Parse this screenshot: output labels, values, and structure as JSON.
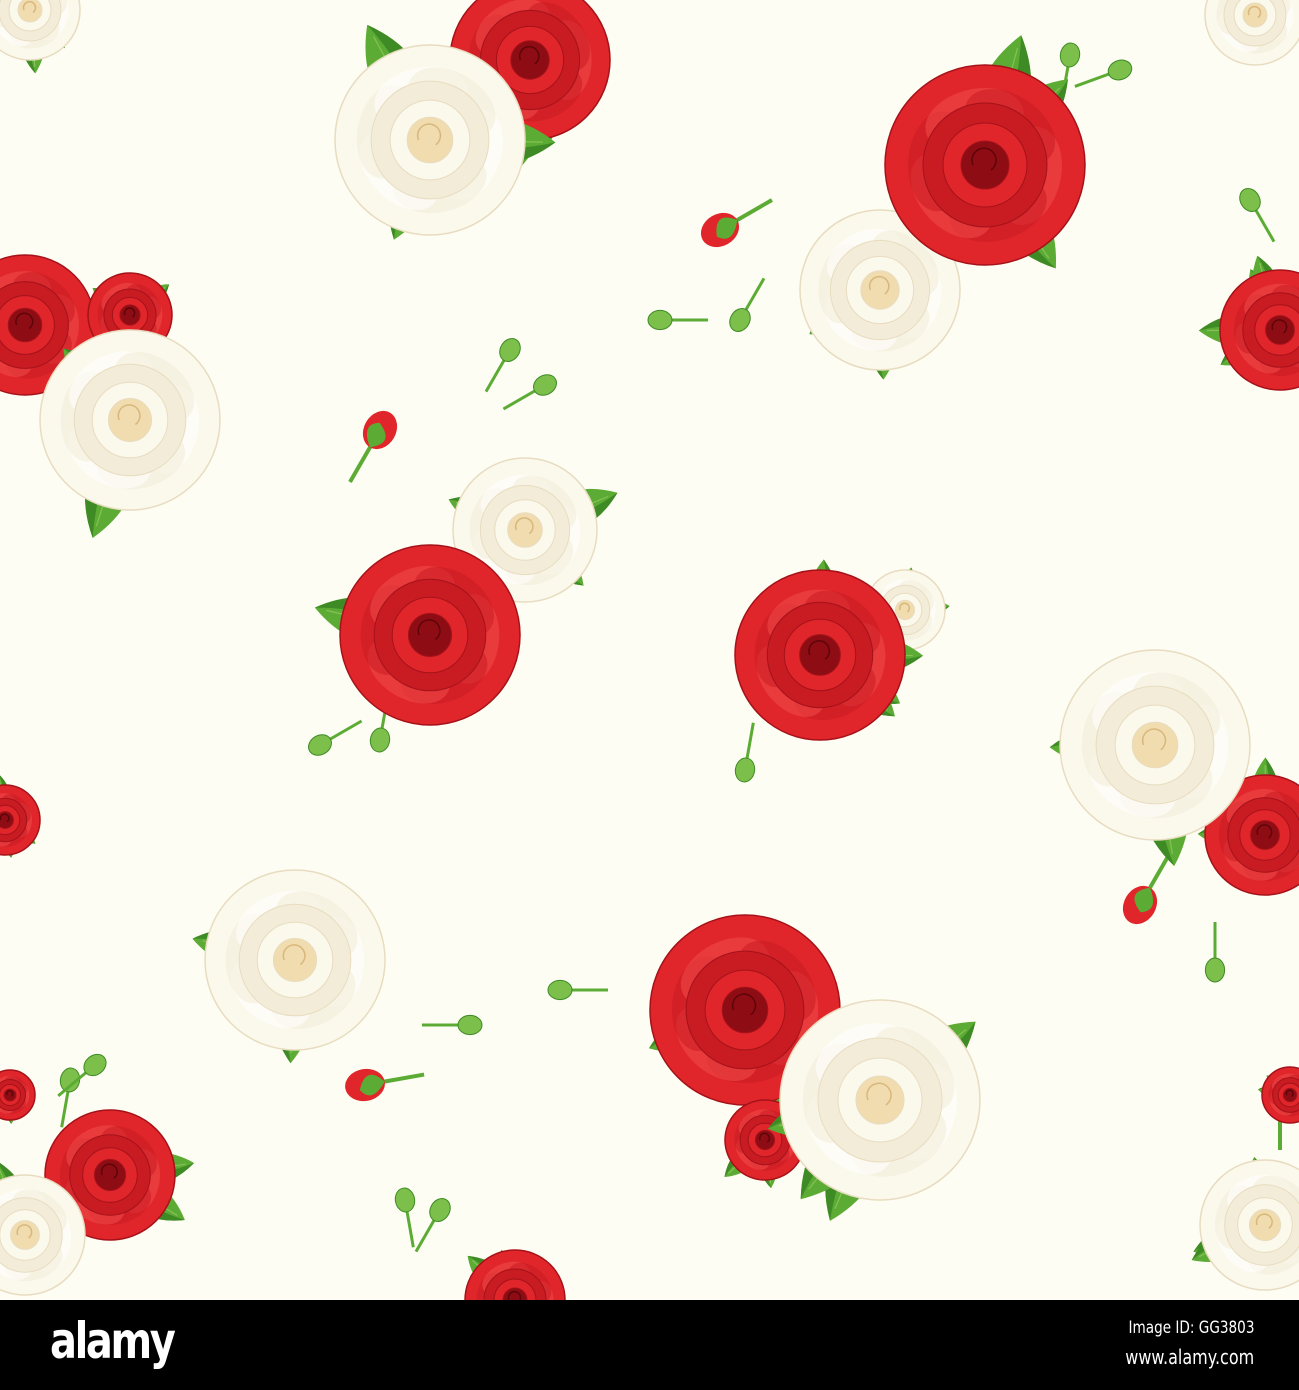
{
  "watermark": {
    "brand": "alamy",
    "image_id": "Image ID: GG3803",
    "url": "www.alamy.com"
  },
  "colors": {
    "background": "#fdfdf3",
    "red_rose": "#e0262a",
    "white_rose": "#fbf8ec",
    "leaf": "#5cab34",
    "leaf_dark": "#3e8a25"
  }
}
